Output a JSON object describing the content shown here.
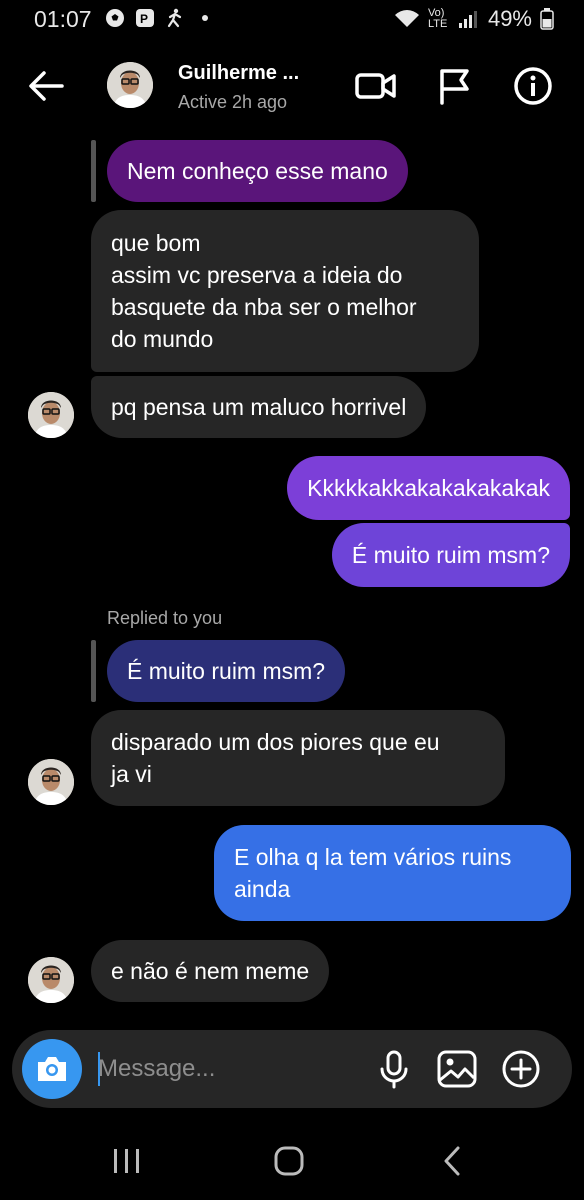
{
  "status_bar": {
    "time": "01:07",
    "network": "Vo) LTE",
    "battery": "49%"
  },
  "header": {
    "name": "Guilherme ...",
    "status": "Active 2h ago"
  },
  "messages": {
    "quote1": "Nem conheço esse mano",
    "in1": "que bom\nassim vc preserva a ideia do\nbasquete da nba ser o melhor\ndo mundo",
    "in2": "pq pensa um maluco horrivel",
    "out1": "Kkkkkakkakakakakakak",
    "out2": "É muito ruim msm?",
    "replied_label": "Replied to you",
    "quote2": "É muito ruim msm?",
    "in3": "disparado um dos piores que eu\nja vi",
    "out3": "E olha q la tem vários ruins\nainda",
    "in4": "e não é nem meme"
  },
  "composer": {
    "placeholder": "Message..."
  },
  "colors": {
    "incoming": "#262626",
    "quote_purple": "#5a157a",
    "quote_blue": "#2b2f78",
    "outgoing_purple": "#7c3fd8",
    "outgoing_blue": "#3670e6",
    "accent": "#3797f0"
  },
  "icons": {
    "back": "arrow-left-icon",
    "video": "video-camera-icon",
    "flag": "flag-icon",
    "info": "info-icon",
    "camera": "camera-icon",
    "mic": "microphone-icon",
    "gallery": "image-gallery-icon",
    "plus": "plus-circle-icon"
  }
}
